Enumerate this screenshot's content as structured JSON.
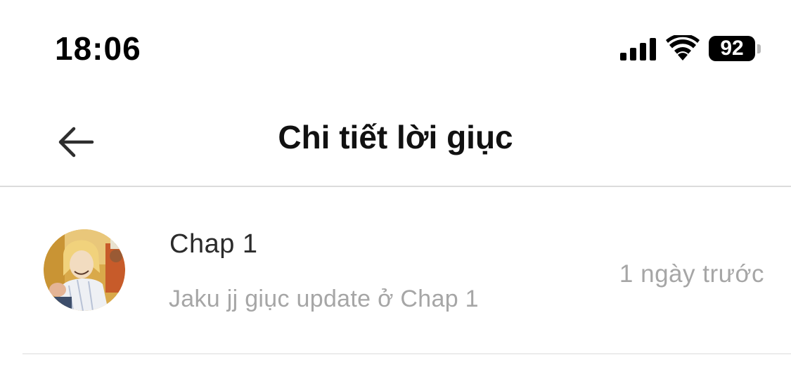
{
  "status_bar": {
    "time": "18:06",
    "battery_level": "92",
    "icons": [
      "signal-icon",
      "wifi-icon",
      "battery-icon"
    ]
  },
  "header": {
    "back_icon": "arrow-left-icon",
    "title": "Chi tiết lời giục"
  },
  "notification": {
    "title": "Chap 1",
    "message": "Jaku jj giục update ở Chap 1",
    "time": "1 ngày trước",
    "avatar": "manga-character-avatar"
  },
  "colors": {
    "background": "#ffffff",
    "title_text": "#111111",
    "secondary_text": "#a6a6a6",
    "divider": "#dcdcdc"
  }
}
